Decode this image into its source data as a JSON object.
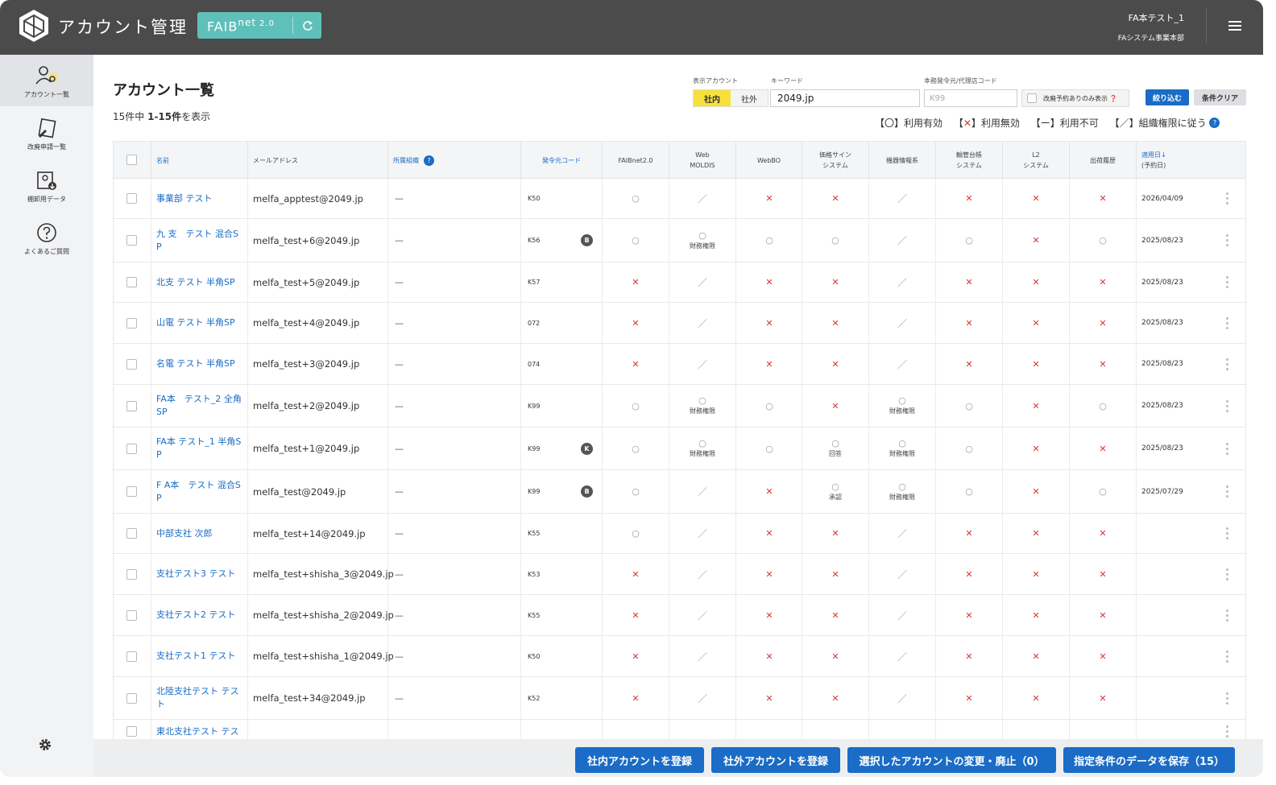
{
  "header": {
    "app_title": "アカウント管理",
    "product_name": "FAIB",
    "product_suffix": "net",
    "product_version": "2.0",
    "user_name": "FA本テスト_1",
    "user_department": "FAシステム事業本部"
  },
  "sidebar": {
    "items": [
      {
        "label": "アカウント一覧",
        "icon": "user-gear-icon",
        "active": true
      },
      {
        "label": "改廃申請一覧",
        "icon": "document-edit-icon",
        "active": false
      },
      {
        "label": "棚卸用データ",
        "icon": "data-export-icon",
        "active": false
      },
      {
        "label": "よくあるご質問",
        "icon": "question-icon",
        "active": false
      }
    ]
  },
  "page": {
    "title": "アカウント一覧",
    "count_prefix": "15件中 ",
    "count_range": "1-15件",
    "count_suffix": "を表示"
  },
  "filters": {
    "display_account_label": "表示アカウント",
    "internal_label": "社内",
    "external_label": "社外",
    "keyword_label": "キーワード",
    "keyword_value": "2049.jp",
    "code_label": "本務発令元/代理店コード",
    "code_placeholder": "K99",
    "reserve_only_label": "改廃予約ありのみ表示",
    "filter_button": "絞り込む",
    "clear_button": "条件クリア"
  },
  "legend": {
    "valid": "【〇】利用有効",
    "invalid_open": "【",
    "invalid_mark": "✕",
    "invalid_close": "】利用無効",
    "unavailable": "【ー】利用不可",
    "org": "【／】組織権限に従う"
  },
  "table": {
    "columns": {
      "name": "名前",
      "email": "メールアドレス",
      "org": "所属組織",
      "code": "発令元コード",
      "faibnet": "FAIBnet2.0",
      "web_moldis_1": "Web",
      "web_moldis_2": "MOLDIS",
      "webbo": "WebBO",
      "price_sign_1": "価格サイン",
      "price_sign_2": "システム",
      "equipment": "機器情報系",
      "ledger_1": "輸管台帳",
      "ledger_2": "システム",
      "l2_1": "L2",
      "l2_2": "システム",
      "shipping": "出荷履歴",
      "date_1": "適用日↓",
      "date_2": "(予約日)"
    },
    "rows": [
      {
        "name": "事業部 テスト",
        "email": "melfa_apptest@2049.jp",
        "org": "—",
        "code": "K50",
        "badge": "",
        "s": [
          "o",
          "s",
          "x",
          "x",
          "s",
          "x",
          "x",
          "x"
        ],
        "subs": [
          "",
          "",
          "",
          "",
          "",
          "",
          "",
          ""
        ],
        "date": "2026/04/09"
      },
      {
        "name": "九 支　テスト 混合S P",
        "email": "melfa_test+6@2049.jp",
        "org": "—",
        "code": "K56",
        "badge": "B",
        "s": [
          "o",
          "o",
          "o",
          "o",
          "s",
          "o",
          "x",
          "o"
        ],
        "subs": [
          "",
          "財務権限",
          "",
          "",
          "",
          "",
          "",
          ""
        ],
        "date": "2025/08/23"
      },
      {
        "name": "北支 テスト 半角SP",
        "email": "melfa_test+5@2049.jp",
        "org": "—",
        "code": "K57",
        "badge": "",
        "s": [
          "x",
          "s",
          "x",
          "x",
          "s",
          "x",
          "x",
          "x"
        ],
        "subs": [
          "",
          "",
          "",
          "",
          "",
          "",
          "",
          ""
        ],
        "date": "2025/08/23"
      },
      {
        "name": "山電 テスト 半角SP",
        "email": "melfa_test+4@2049.jp",
        "org": "—",
        "code": "072",
        "badge": "",
        "s": [
          "x",
          "s",
          "x",
          "x",
          "s",
          "x",
          "x",
          "x"
        ],
        "subs": [
          "",
          "",
          "",
          "",
          "",
          "",
          "",
          ""
        ],
        "date": "2025/08/23"
      },
      {
        "name": "名電 テスト 半角SP",
        "email": "melfa_test+3@2049.jp",
        "org": "—",
        "code": "074",
        "badge": "",
        "s": [
          "x",
          "s",
          "x",
          "x",
          "s",
          "x",
          "x",
          "x"
        ],
        "subs": [
          "",
          "",
          "",
          "",
          "",
          "",
          "",
          ""
        ],
        "date": "2025/08/23"
      },
      {
        "name": "FA本　テスト_2 全角SP",
        "email": "melfa_test+2@2049.jp",
        "org": "—",
        "code": "K99",
        "badge": "",
        "s": [
          "o",
          "o",
          "o",
          "x",
          "o",
          "o",
          "x",
          "o"
        ],
        "subs": [
          "",
          "財務権限",
          "",
          "",
          "財務権限",
          "",
          "",
          ""
        ],
        "date": "2025/08/23"
      },
      {
        "name": "FA本 テスト_1 半角S P",
        "email": "melfa_test+1@2049.jp",
        "org": "—",
        "code": "K99",
        "badge": "K",
        "s": [
          "o",
          "o",
          "o",
          "o",
          "o",
          "o",
          "x",
          "x"
        ],
        "subs": [
          "",
          "財務権限",
          "",
          "回答",
          "財務権限",
          "",
          "",
          ""
        ],
        "date": "2025/08/23"
      },
      {
        "name": "F A本　テスト 混合S P",
        "email": "melfa_test@2049.jp",
        "org": "—",
        "code": "K99",
        "badge": "B",
        "s": [
          "o",
          "s",
          "x",
          "o",
          "o",
          "o",
          "x",
          "o"
        ],
        "subs": [
          "",
          "",
          "",
          "承認",
          "財務権限",
          "",
          "",
          ""
        ],
        "date": "2025/07/29"
      },
      {
        "name": "中部支社 次郎",
        "email": "melfa_test+14@2049.jp",
        "org": "—",
        "code": "K55",
        "badge": "",
        "s": [
          "o",
          "s",
          "x",
          "x",
          "s",
          "x",
          "x",
          "x"
        ],
        "subs": [
          "",
          "",
          "",
          "",
          "",
          "",
          "",
          ""
        ],
        "date": ""
      },
      {
        "name": "支社テスト3 テスト",
        "email": "melfa_test+shisha_3@2049.jp",
        "org": "—",
        "code": "K53",
        "badge": "",
        "s": [
          "x",
          "s",
          "x",
          "x",
          "s",
          "x",
          "x",
          "x"
        ],
        "subs": [
          "",
          "",
          "",
          "",
          "",
          "",
          "",
          ""
        ],
        "date": ""
      },
      {
        "name": "支社テスト2 テスト",
        "email": "melfa_test+shisha_2@2049.jp",
        "org": "—",
        "code": "K55",
        "badge": "",
        "s": [
          "x",
          "s",
          "x",
          "x",
          "s",
          "x",
          "x",
          "x"
        ],
        "subs": [
          "",
          "",
          "",
          "",
          "",
          "",
          "",
          ""
        ],
        "date": ""
      },
      {
        "name": "支社テスト1 テスト",
        "email": "melfa_test+shisha_1@2049.jp",
        "org": "—",
        "code": "K50",
        "badge": "",
        "s": [
          "x",
          "s",
          "x",
          "x",
          "s",
          "x",
          "x",
          "x"
        ],
        "subs": [
          "",
          "",
          "",
          "",
          "",
          "",
          "",
          ""
        ],
        "date": ""
      },
      {
        "name": "北陸支社テスト テスト",
        "email": "melfa_test+34@2049.jp",
        "org": "—",
        "code": "K52",
        "badge": "",
        "s": [
          "x",
          "s",
          "x",
          "x",
          "s",
          "x",
          "x",
          "x"
        ],
        "subs": [
          "",
          "",
          "",
          "",
          "",
          "",
          "",
          ""
        ],
        "date": ""
      },
      {
        "name": "東北支社テスト テス",
        "email": "",
        "org": "",
        "code": "",
        "badge": "",
        "s": [
          "",
          "",
          "",
          "",
          "",
          "",
          "",
          ""
        ],
        "subs": [
          "",
          "",
          "",
          "",
          "",
          "",
          "",
          ""
        ],
        "date": ""
      }
    ]
  },
  "footer": {
    "register_internal": "社内アカウントを登録",
    "register_external": "社外アカウントを登録",
    "change_selected": "選択したアカウントの変更・廃止（0）",
    "save_data": "指定条件のデータを保存（15）"
  },
  "colors": {
    "header_bg": "#4b4b4b",
    "accent_teal": "#5fc0ba",
    "primary_blue": "#1a6cc6",
    "invalid_red": "#dd3333",
    "active_yellow": "#f7e03c"
  }
}
